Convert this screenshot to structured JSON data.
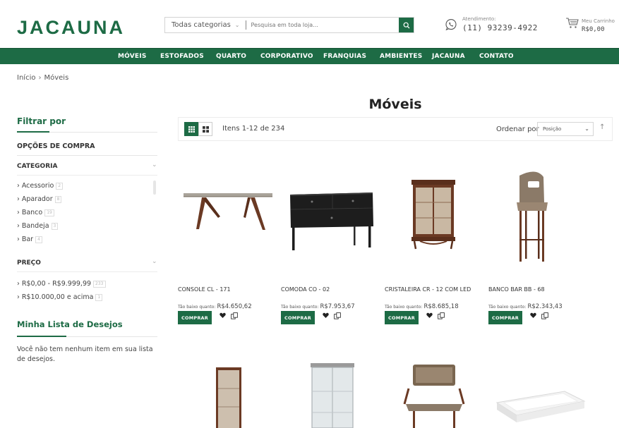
{
  "header": {
    "logo": "JACAUNA",
    "search": {
      "category": "Todas categorias",
      "placeholder": "Pesquisa em toda loja..."
    },
    "contact": {
      "label": "Atendimento:",
      "phone": "(11) 93239-4922"
    },
    "cart": {
      "label": "Meu Carrinho",
      "total": "R$0,00"
    }
  },
  "nav": {
    "items": [
      {
        "label": "MÓVEIS"
      },
      {
        "label": "ESTOFADOS"
      },
      {
        "label": "QUARTO"
      },
      {
        "label": "CORPORATIVO"
      },
      {
        "label": "FRANQUIAS"
      },
      {
        "label": "AMBIENTES"
      },
      {
        "label": "JACAUNA"
      },
      {
        "label": "CONTATO"
      }
    ]
  },
  "breadcrumb": {
    "home": "Início",
    "sep": "›",
    "current": "Móveis"
  },
  "page_title": "Móveis",
  "sidebar": {
    "filter_title": "Filtrar por",
    "options_title": "OPÇÕES DE COMPRA",
    "category": {
      "title": "CATEGORIA",
      "items": [
        {
          "label": "› Acessorio",
          "count": "2"
        },
        {
          "label": "› Aparador",
          "count": "8"
        },
        {
          "label": "› Banco",
          "count": "19"
        },
        {
          "label": "› Bandeja",
          "count": "3"
        },
        {
          "label": "› Bar",
          "count": "4"
        }
      ]
    },
    "price": {
      "title": "PREÇO",
      "items": [
        {
          "label": "› R$0,00  - R$9.999,99",
          "count": "233"
        },
        {
          "label": "› R$10.000,00  e acima",
          "count": "1"
        }
      ]
    },
    "wishlist": {
      "title": "Minha Lista de Desejos",
      "empty_text": "Você não tem nenhum item em sua lista de desejos."
    }
  },
  "toolbar": {
    "items_count": "Itens 1-12 de 234",
    "sort_label": "Ordenar por",
    "sort_value": "Posição"
  },
  "products": [
    {
      "name": "CONSOLE CL - 171",
      "price_label": "Tão baixo quanto:",
      "price": "R$4.650,62",
      "buy_label": "COMPRAR"
    },
    {
      "name": "COMODA CO - 02",
      "price_label": "Tão baixo quanto:",
      "price": "R$7.953,67",
      "buy_label": "COMPRAR"
    },
    {
      "name": "CRISTALEIRA CR - 12 COM LED",
      "price_label": "Tão baixo quanto:",
      "price": "R$8.685,18",
      "buy_label": "COMPRAR"
    },
    {
      "name": "BANCO BAR BB - 68",
      "price_label": "Tão baixo quanto:",
      "price": "R$2.343,43",
      "buy_label": "COMPRAR"
    }
  ],
  "colors": {
    "brand": "#1d6b45",
    "wood": "#6b3a24",
    "black_furniture": "#1d1d1d"
  },
  "icons": [
    "search-icon",
    "whatsapp-icon",
    "cart-icon",
    "grid-view-icon",
    "list-view-icon",
    "sort-arrow-icon",
    "heart-icon",
    "compare-icon"
  ]
}
